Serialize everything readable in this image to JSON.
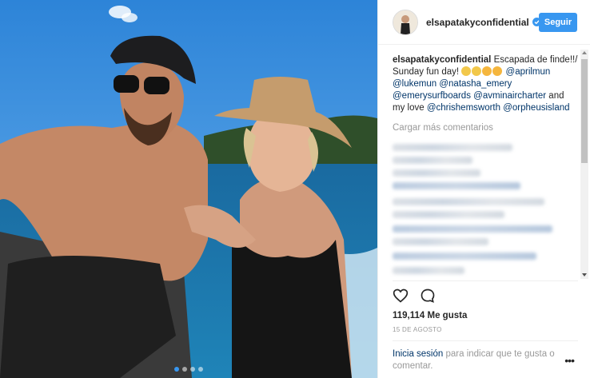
{
  "post": {
    "username": "elsapatakyconfidential",
    "follow_label": "Seguir",
    "caption_user": "elsapatakyconfidential",
    "caption_text_1": "Escapada de finde!!/ Sunday fun day!",
    "mentions": [
      "@aprilmun",
      "@lukemun",
      "@natasha_emery",
      "@emerysurfboards",
      "@avminaircharter"
    ],
    "caption_and": "and my love",
    "mention_love": "@chrishemsworth",
    "mention_place": "@orpheusisland",
    "load_more": "Cargar más comentarios",
    "likes": "119,114 Me gusta",
    "date": "15 DE AGOSTO",
    "login_link": "Inicia sesión",
    "login_rest": "para indicar que te gusta o comentar.",
    "more_label": "•••"
  },
  "icons": {
    "heart": "heart-icon",
    "comment": "comment-icon",
    "verified": "verified-badge-icon",
    "more": "more-options-icon"
  },
  "colors": {
    "accent": "#3897f0",
    "link": "#003569",
    "muted": "#999999"
  }
}
